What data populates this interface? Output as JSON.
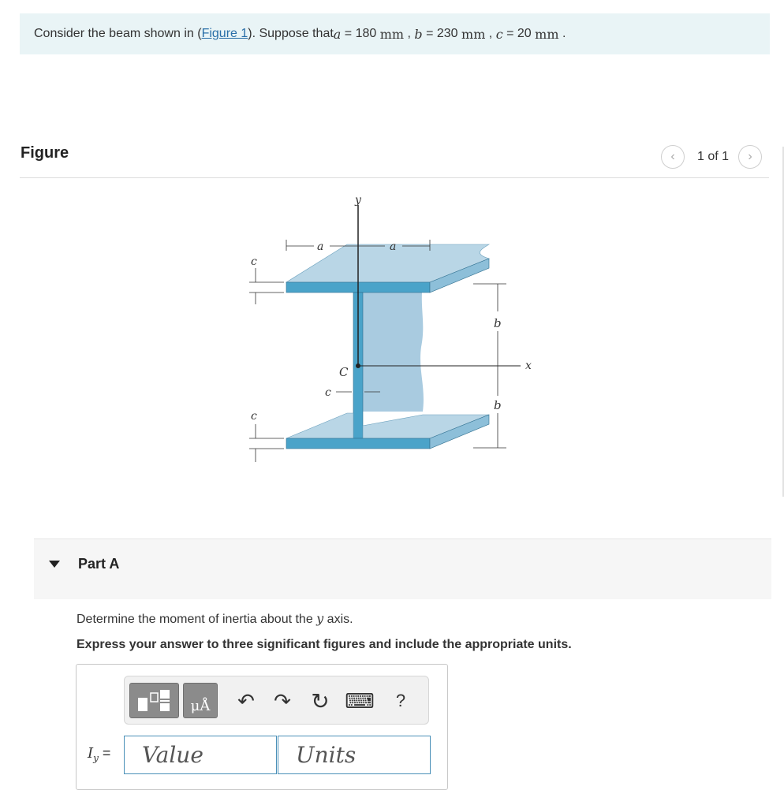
{
  "intro": {
    "prefix": "Consider the beam shown in (",
    "figure_link": "Figure 1",
    "middle": "). Suppose that ",
    "a_var": "a",
    "a_val": " = 180 ",
    "a_unit": "mm",
    "sep1": " , ",
    "b_var": "b",
    "b_val": " = 230 ",
    "b_unit": "mm",
    "sep2": " , ",
    "c_var": "c",
    "c_val": " = 20 ",
    "c_unit": "mm",
    "end": " ."
  },
  "figure": {
    "title": "Figure",
    "pager": "1 of 1",
    "prev_icon": "‹",
    "next_icon": "›",
    "labels": {
      "y": "y",
      "x": "x",
      "a_left": "a",
      "a_right": "a",
      "c_top": "c",
      "c_bottom": "c",
      "c_web": "c",
      "C": "C",
      "b_top": "b",
      "b_bottom": "b"
    },
    "colors": {
      "flange_top": "#b9d6e6",
      "flange_front": "#4aa3c9",
      "web": "#a9cbe0",
      "web_front": "#4aa3c9",
      "edge": "#2f6f8f"
    }
  },
  "part": {
    "label": "Part A",
    "question": "Determine the moment of inertia about the ",
    "question_var": "y",
    "question_end": " axis.",
    "instruction": "Express your answer to three significant figures and include the appropriate units."
  },
  "answer": {
    "var_label": "I",
    "var_sub": "y",
    "equals": " =",
    "value_placeholder": "Value",
    "units_placeholder": "Units",
    "toolbar": {
      "templates_icon": "templates-icon",
      "units_label": "μÅ",
      "undo_icon": "↶",
      "redo_icon": "↷",
      "reset_icon": "↻",
      "keyboard_icon": "⌨",
      "help_label": "?"
    }
  }
}
